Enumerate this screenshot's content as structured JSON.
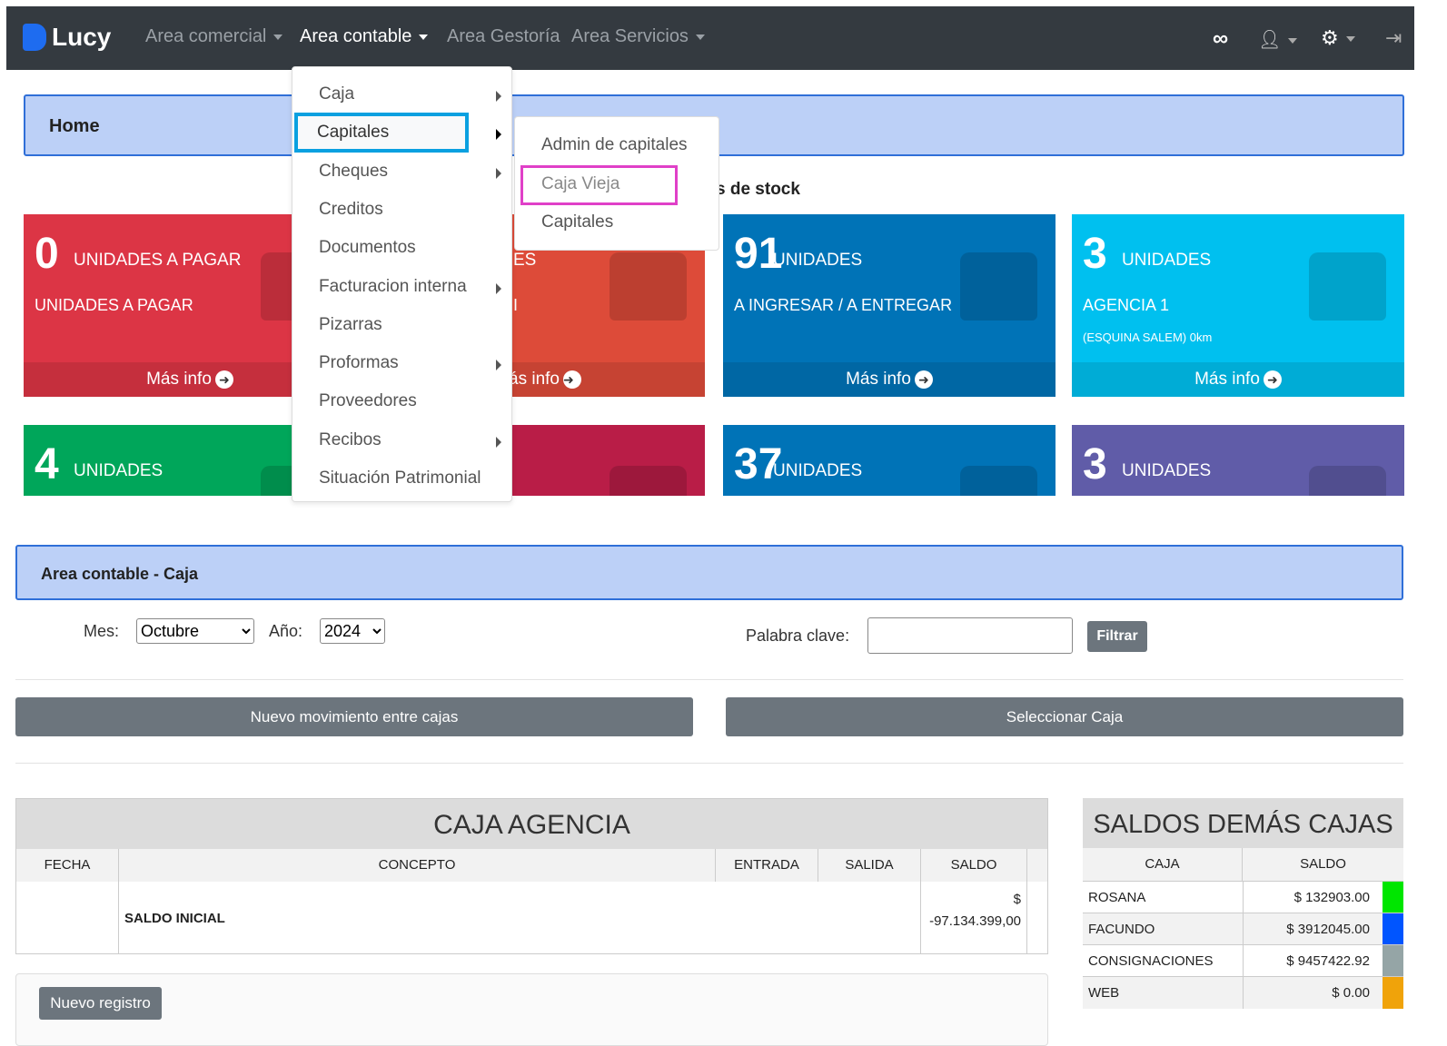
{
  "navbar": {
    "brand": "Lucy",
    "items": [
      {
        "label": "Area comercial",
        "caret": true
      },
      {
        "label": "Area contable",
        "caret": true,
        "active": true
      },
      {
        "label": "Area Gestoría",
        "caret": false
      },
      {
        "label": "Area Servicios",
        "caret": true
      }
    ],
    "icons": [
      "infinity-icon",
      "user-icon",
      "gear-icon",
      "logout-icon"
    ]
  },
  "home": {
    "title": "Home",
    "stock_heading": "s de stock"
  },
  "cards_row1": [
    {
      "num": "0",
      "title": "UNIDADES A PAGAR",
      "sub": "UNIDADES A PAGAR",
      "sub2": "",
      "footer": "Más info",
      "color": "#dc3545"
    },
    {
      "num": "",
      "title": "ES",
      "sub": "I",
      "sub2": "",
      "footer": "ás info",
      "color": "#dd4b39"
    },
    {
      "num": "91",
      "title": "UNIDADES",
      "sub": "A INGRESAR / A ENTREGAR",
      "sub2": "",
      "footer": "Más info",
      "color": "#0073b7"
    },
    {
      "num": "3",
      "title": "UNIDADES",
      "sub": "AGENCIA 1",
      "sub2": "(ESQUINA SALEM) 0km",
      "footer": "Más info",
      "color": "#00c0ef"
    }
  ],
  "cards_row2": [
    {
      "num": "4",
      "title": "UNIDADES",
      "color": "#00a65a"
    },
    {
      "num": "",
      "title": "",
      "color": "#b91d47"
    },
    {
      "num": "37",
      "title": "UNIDADES",
      "color": "#0073b7"
    },
    {
      "num": "3",
      "title": "UNIDADES",
      "color": "#605ca8"
    }
  ],
  "menu": {
    "items": [
      {
        "label": "Caja",
        "sub": true
      },
      {
        "label": "Capitales",
        "sub": true
      },
      {
        "label": "Cheques",
        "sub": true
      },
      {
        "label": "Creditos",
        "sub": false
      },
      {
        "label": "Documentos",
        "sub": false
      },
      {
        "label": "Facturacion interna",
        "sub": true
      },
      {
        "label": "Pizarras",
        "sub": false
      },
      {
        "label": "Proformas",
        "sub": true
      },
      {
        "label": "Proveedores",
        "sub": false
      },
      {
        "label": "Recibos",
        "sub": true
      },
      {
        "label": "Situación Patrimonial",
        "sub": false
      }
    ],
    "submenu": [
      "Admin de capitales",
      "Caja Vieja",
      "Capitales"
    ]
  },
  "caja": {
    "title": "Area contable - Caja",
    "mes_label": "Mes:",
    "mes_value": "Octubre",
    "anio_label": "Año:",
    "anio_value": "2024",
    "keyword_label": "Palabra clave:",
    "keyword_value": "",
    "filter_btn": "Filtrar",
    "btn_mov": "Nuevo movimiento entre cajas",
    "btn_sel": "Seleccionar Caja"
  },
  "agencia": {
    "title": "CAJA AGENCIA",
    "headers": [
      "FECHA",
      "CONCEPTO",
      "ENTRADA",
      "SALIDA",
      "SALDO"
    ],
    "row": {
      "fecha": "",
      "concepto": "SALDO INICIAL",
      "entrada": "",
      "salida": "",
      "saldo_sym": "$",
      "saldo": "-97.134.399,00"
    },
    "new_btn": "Nuevo registro"
  },
  "saldos": {
    "title": "SALDOS DEMÁS CAJAS",
    "headers": [
      "CAJA",
      "SALDO"
    ],
    "rows": [
      {
        "caja": "ROSANA",
        "saldo": "$ 132903.00",
        "color": "#00e600"
      },
      {
        "caja": "FACUNDO",
        "saldo": "$ 3912045.00",
        "color": "#0055ff"
      },
      {
        "caja": "CONSIGNACIONES",
        "saldo": "$ 9457422.92",
        "color": "#95a5a6"
      },
      {
        "caja": "WEB",
        "saldo": "$ 0.00",
        "color": "#f0a30a"
      }
    ]
  }
}
